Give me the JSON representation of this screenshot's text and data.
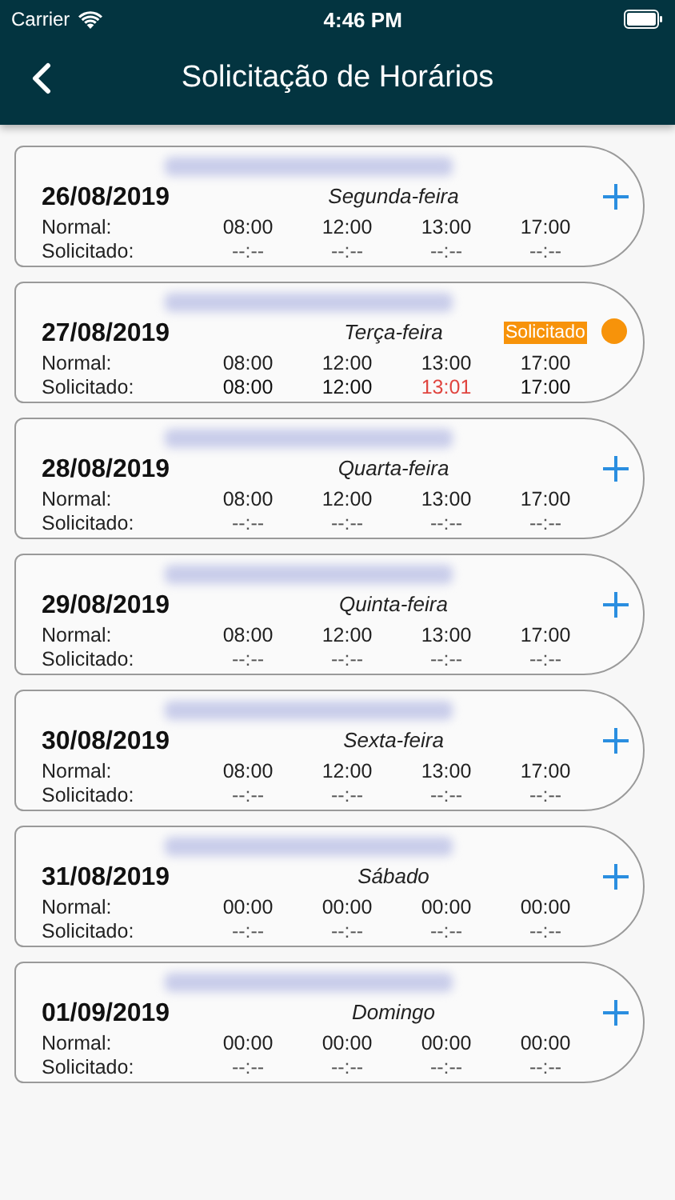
{
  "status_bar": {
    "carrier": "Carrier",
    "time": "4:46 PM"
  },
  "nav": {
    "title": "Solicitação de Horários"
  },
  "days": [
    {
      "kind": "add",
      "date": "26/08/2019",
      "weekday": "Segunda-feira",
      "normal_label": "Normal:",
      "normal": [
        "08:00",
        "12:00",
        "13:00",
        "17:00"
      ],
      "requested_label": "Solicitado:",
      "requested": [
        {
          "time": "--:--",
          "changed": false
        },
        {
          "time": "--:--",
          "changed": false
        },
        {
          "time": "--:--",
          "changed": false
        },
        {
          "time": "--:--",
          "changed": false
        }
      ]
    },
    {
      "kind": "requested",
      "badge": "Solicitado",
      "date": "27/08/2019",
      "weekday": "Terça-feira",
      "normal_label": "Normal:",
      "normal": [
        "08:00",
        "12:00",
        "13:00",
        "17:00"
      ],
      "requested_label": "Solicitado:",
      "requested": [
        {
          "time": "08:00",
          "changed": false
        },
        {
          "time": "12:00",
          "changed": false
        },
        {
          "time": "13:01",
          "changed": true
        },
        {
          "time": "17:00",
          "changed": false
        }
      ]
    },
    {
      "kind": "add",
      "date": "28/08/2019",
      "weekday": "Quarta-feira",
      "normal_label": "Normal:",
      "normal": [
        "08:00",
        "12:00",
        "13:00",
        "17:00"
      ],
      "requested_label": "Solicitado:",
      "requested": [
        {
          "time": "--:--",
          "changed": false
        },
        {
          "time": "--:--",
          "changed": false
        },
        {
          "time": "--:--",
          "changed": false
        },
        {
          "time": "--:--",
          "changed": false
        }
      ]
    },
    {
      "kind": "add",
      "date": "29/08/2019",
      "weekday": "Quinta-feira",
      "normal_label": "Normal:",
      "normal": [
        "08:00",
        "12:00",
        "13:00",
        "17:00"
      ],
      "requested_label": "Solicitado:",
      "requested": [
        {
          "time": "--:--",
          "changed": false
        },
        {
          "time": "--:--",
          "changed": false
        },
        {
          "time": "--:--",
          "changed": false
        },
        {
          "time": "--:--",
          "changed": false
        }
      ]
    },
    {
      "kind": "add",
      "date": "30/08/2019",
      "weekday": "Sexta-feira",
      "normal_label": "Normal:",
      "normal": [
        "08:00",
        "12:00",
        "13:00",
        "17:00"
      ],
      "requested_label": "Solicitado:",
      "requested": [
        {
          "time": "--:--",
          "changed": false
        },
        {
          "time": "--:--",
          "changed": false
        },
        {
          "time": "--:--",
          "changed": false
        },
        {
          "time": "--:--",
          "changed": false
        }
      ]
    },
    {
      "kind": "add",
      "date": "31/08/2019",
      "weekday": "Sábado",
      "normal_label": "Normal:",
      "normal": [
        "00:00",
        "00:00",
        "00:00",
        "00:00"
      ],
      "requested_label": "Solicitado:",
      "requested": [
        {
          "time": "--:--",
          "changed": false
        },
        {
          "time": "--:--",
          "changed": false
        },
        {
          "time": "--:--",
          "changed": false
        },
        {
          "time": "--:--",
          "changed": false
        }
      ]
    },
    {
      "kind": "add",
      "date": "01/09/2019",
      "weekday": "Domingo",
      "normal_label": "Normal:",
      "normal": [
        "00:00",
        "00:00",
        "00:00",
        "00:00"
      ],
      "requested_label": "Solicitado:",
      "requested": [
        {
          "time": "--:--",
          "changed": false
        },
        {
          "time": "--:--",
          "changed": false
        },
        {
          "time": "--:--",
          "changed": false
        },
        {
          "time": "--:--",
          "changed": false
        }
      ]
    }
  ]
}
